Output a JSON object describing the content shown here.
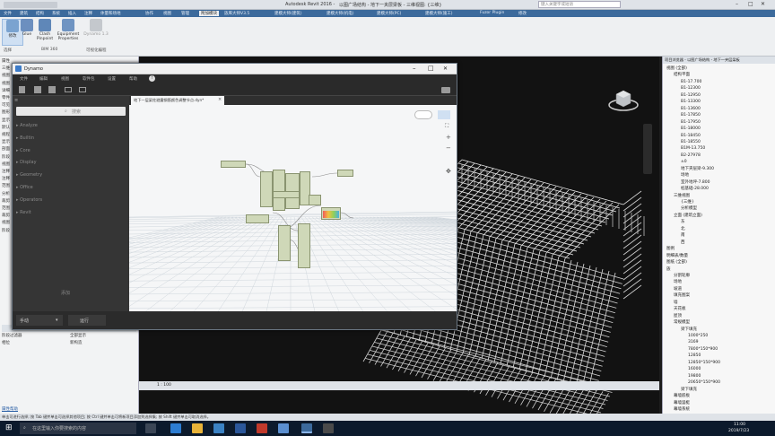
{
  "window": {
    "title": "Autodesk Revit 2016 -",
    "doc_title": "以图广场结构 - 地下一夹层梁板 - 三维视图: {三维}",
    "search_placeholder": "键入关键字或短语"
  },
  "menubar": {
    "items": [
      "文件",
      "建筑",
      "结构",
      "系统",
      "插入",
      "注释",
      "体量和场地",
      "协作",
      "视图",
      "管理",
      "附加模块",
      "族库大师V3.5",
      "建模大师(建筑)",
      "建模大师(机电)",
      "建模大师(PC)",
      "建模大师(施工)",
      "Fuzor Plugin",
      "修改"
    ]
  },
  "ribbon": {
    "buttons": [
      {
        "label": "修改",
        "icon": "modify-icon"
      },
      {
        "label": "Glue",
        "icon": "glue-icon"
      },
      {
        "label": "Clash Pinpoint",
        "icon": "clash-icon"
      },
      {
        "label": "Equipment Properties",
        "icon": "equipment-icon"
      },
      {
        "label": "Dynamo 1.3",
        "icon": "dynamo-icon"
      }
    ],
    "groups": [
      "选择",
      "BIM 360",
      "可视化编程"
    ]
  },
  "dynamo": {
    "title": "Dynamo",
    "menu": [
      "文件",
      "编辑",
      "视图",
      "软件包",
      "设置",
      "帮助"
    ],
    "search_placeholder": "搜索",
    "library": [
      "Analyze",
      "Builtin",
      "Core",
      "Display",
      "Geometry",
      "Office",
      "Operators",
      "Revit"
    ],
    "add_label": "添加",
    "tab_title": "地下一层梁柱避震钢筋颜色调整节点.dyn*",
    "run_mode": "手动",
    "run_button": "运行"
  },
  "left_panel": {
    "labels": [
      "属性",
      "三维",
      "视图",
      "视图",
      "详细",
      "零件",
      "可见",
      "图形",
      "显示",
      "默认",
      "规程",
      "显示",
      "剖面",
      "阶段",
      "视图",
      "注释",
      "注释",
      "范围",
      "分析",
      "裁剪",
      "范围",
      "裁剪",
      "视图",
      "阶段"
    ],
    "bottom": {
      "link": "属性帮助",
      "rows": [
        [
          "阶段过滤器",
          "全部显示"
        ],
        [
          "相位",
          "新构造"
        ]
      ]
    }
  },
  "view_control": {
    "scale": "1 : 100"
  },
  "project_browser": {
    "title": "项目浏览器 - 以图广场结构 - 地下一夹层梁板",
    "items": [
      {
        "text": "视图 (全部)",
        "level": 0
      },
      {
        "text": "结构平面",
        "level": 1
      },
      {
        "text": "B1-17.700",
        "level": 2
      },
      {
        "text": "B1-12300",
        "level": 2
      },
      {
        "text": "B1-12950",
        "level": 2
      },
      {
        "text": "B1-13300",
        "level": 2
      },
      {
        "text": "B1-13600",
        "level": 2
      },
      {
        "text": "B1-17850",
        "level": 2
      },
      {
        "text": "B1-17950",
        "level": 2
      },
      {
        "text": "B1-18000",
        "level": 2
      },
      {
        "text": "B1-18450",
        "level": 2
      },
      {
        "text": "B1-18550",
        "level": 2
      },
      {
        "text": "B1M-13.750",
        "level": 2
      },
      {
        "text": "B2-27978",
        "level": 2
      },
      {
        "text": "±0",
        "level": 2
      },
      {
        "text": "地下夹层梁-9.300",
        "level": 2
      },
      {
        "text": "场地",
        "level": 2
      },
      {
        "text": "室外地坪-7.800",
        "level": 2
      },
      {
        "text": "桩基础-28.000",
        "level": 2
      },
      {
        "text": "三维视图",
        "level": 1
      },
      {
        "text": "{三维}",
        "level": 2
      },
      {
        "text": "分析模型",
        "level": 2
      },
      {
        "text": "立面 (建筑立面)",
        "level": 1
      },
      {
        "text": "东",
        "level": 2
      },
      {
        "text": "北",
        "level": 2
      },
      {
        "text": "南",
        "level": 2
      },
      {
        "text": "西",
        "level": 2
      },
      {
        "text": "图例",
        "level": 0
      },
      {
        "text": "明细表/数量",
        "level": 0
      },
      {
        "text": "图纸 (全部)",
        "level": 0
      },
      {
        "text": "族",
        "level": 0
      },
      {
        "text": "分割轮廓",
        "level": 1
      },
      {
        "text": "场地",
        "level": 1
      },
      {
        "text": "坡道",
        "level": 1
      },
      {
        "text": "填充图案",
        "level": 1
      },
      {
        "text": "墙",
        "level": 1
      },
      {
        "text": "天花板",
        "level": 1
      },
      {
        "text": "屋顶",
        "level": 1
      },
      {
        "text": "常规模型",
        "level": 1
      },
      {
        "text": "梁下填充",
        "level": 2
      },
      {
        "text": "1000*250",
        "level": 3
      },
      {
        "text": "3169",
        "level": 3
      },
      {
        "text": "7800*150*900",
        "level": 3
      },
      {
        "text": "12850",
        "level": 3
      },
      {
        "text": "12850*150*900",
        "level": 3
      },
      {
        "text": "16000",
        "level": 3
      },
      {
        "text": "19800",
        "level": 3
      },
      {
        "text": "20650*150*900",
        "level": 3
      },
      {
        "text": "梁下填充",
        "level": 2
      },
      {
        "text": "幕墙嵌板",
        "level": 1
      },
      {
        "text": "幕墙竖梃",
        "level": 1
      },
      {
        "text": "幕墙系统",
        "level": 1
      }
    ]
  },
  "statusbar": {
    "text": "单击可进行选择; 按 Tab 键并单击可选择其他项目; 按 Ctrl 键并单击可将新项目添加到选择集; 按 Shift 键并单击可取消选择。"
  },
  "taskbar": {
    "search_placeholder": "在这里输入你要搜索的内容",
    "time": "11:00",
    "date": "2019/7/23"
  },
  "colors": {
    "accent": "#3c6a9c",
    "viewport": "#121212",
    "dynamo_dark": "#333333",
    "node": "#cfd8b8"
  }
}
